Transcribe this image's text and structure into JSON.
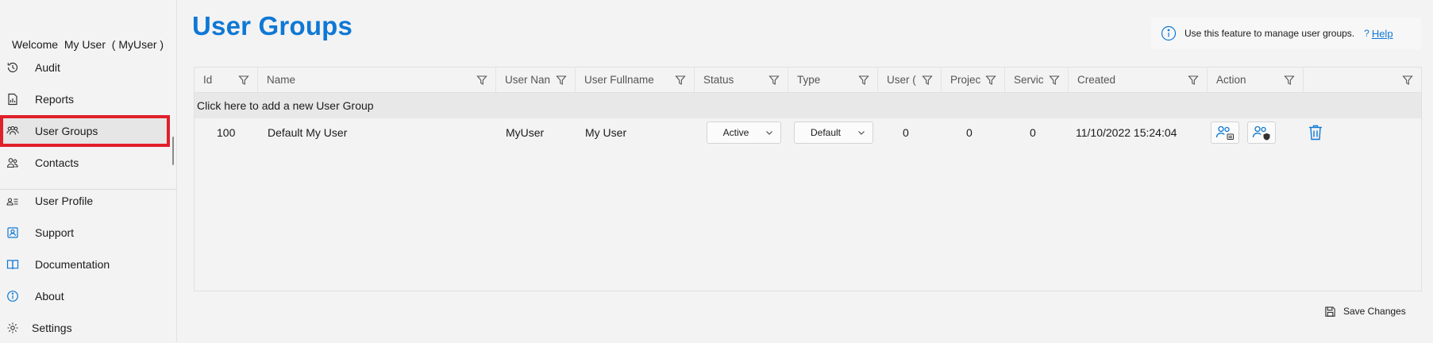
{
  "sidebar": {
    "welcome": "Welcome  My User  ( MyUser )",
    "items": [
      {
        "label": "Audit",
        "icon": "history-icon"
      },
      {
        "label": "Reports",
        "icon": "report-icon"
      },
      {
        "label": "User Groups",
        "icon": "user-groups-icon"
      },
      {
        "label": "Contacts",
        "icon": "contacts-icon"
      },
      {
        "label": "User Profile",
        "icon": "user-profile-icon"
      },
      {
        "label": "Support",
        "icon": "support-icon"
      },
      {
        "label": "Documentation",
        "icon": "book-icon"
      },
      {
        "label": "About",
        "icon": "info-icon"
      },
      {
        "label": "Settings",
        "icon": "gear-icon"
      }
    ],
    "active": "User Groups"
  },
  "header": {
    "title": "User Groups",
    "info_text": "Use this feature to manage user groups.",
    "help_prefix": "?",
    "help_label": "Help"
  },
  "grid": {
    "columns": [
      "Id",
      "Name",
      "User Nan",
      "User Fullname",
      "Status",
      "Type",
      "User (",
      "Projec",
      "Servic",
      "Created",
      "Action",
      ""
    ],
    "add_row_label": "Click here to add a new User Group",
    "rows": [
      {
        "id": "100",
        "name": "Default My User",
        "user_name": "MyUser",
        "user_fullname": "My User",
        "status": "Active",
        "type": "Default",
        "users": "0",
        "projects": "0",
        "services": "0",
        "created": "11/10/2022 15:24:04"
      }
    ]
  },
  "footer": {
    "save_label": "Save Changes"
  },
  "colors": {
    "accent": "#0f78d4",
    "highlight": "#e0202a"
  }
}
